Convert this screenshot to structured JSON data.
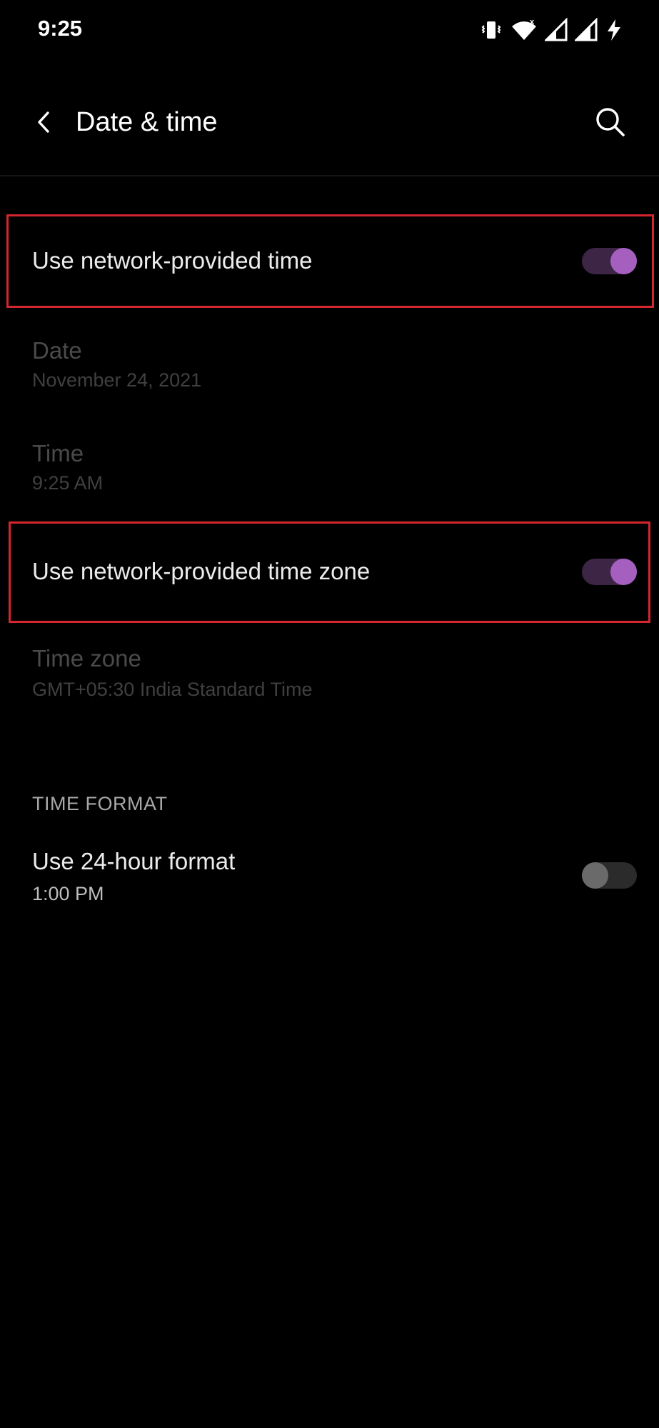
{
  "status_bar": {
    "time": "9:25",
    "icons": [
      "vibrate-icon",
      "wifi-icon",
      "signal-x-icon",
      "signal-icon",
      "charging-icon"
    ]
  },
  "header": {
    "title": "Date & time",
    "back_icon": "back-arrow-icon",
    "search_icon": "search-icon"
  },
  "settings": {
    "network_time": {
      "label": "Use network-provided time",
      "enabled": true
    },
    "date": {
      "label": "Date",
      "value": "November 24, 2021",
      "disabled": true
    },
    "time": {
      "label": "Time",
      "value": "9:25 AM",
      "disabled": true
    },
    "network_time_zone": {
      "label": "Use network-provided time zone",
      "enabled": true
    },
    "time_zone": {
      "label": "Time zone",
      "value": "GMT+05:30 India Standard Time",
      "disabled": true
    }
  },
  "time_format": {
    "section_title": "TIME FORMAT",
    "use_24_hour": {
      "label": "Use 24-hour format",
      "value": "1:00 PM",
      "enabled": false
    }
  },
  "colors": {
    "background": "#000000",
    "accent": "#a45fbf",
    "toggle_track_on": "#3d2546",
    "highlight_border": "#d3262e",
    "disabled_text": "#4a4a4a"
  }
}
